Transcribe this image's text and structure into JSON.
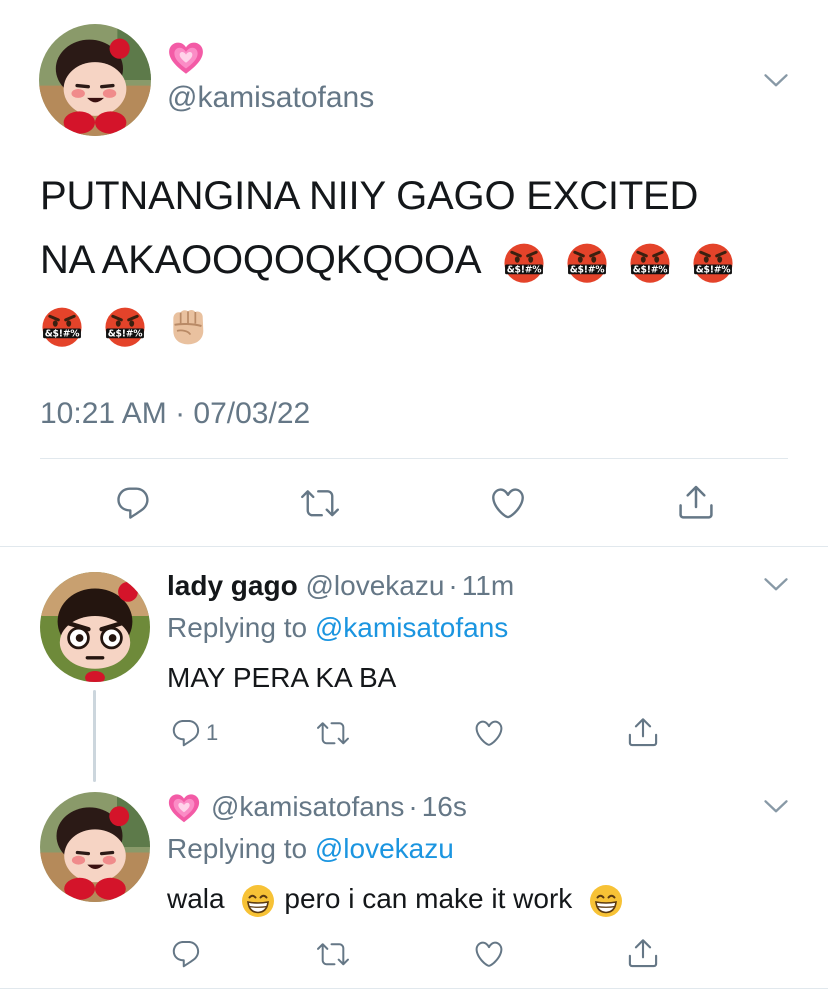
{
  "main_tweet": {
    "handle": "@kamisatofans",
    "text_line1": "PUTNANGINA NIIY GAGO EXCITED",
    "text_line2": "NA AKAOOQOQKQOOA",
    "timestamp": "10:21 AM · 07/03/22",
    "name_emoji": "sparkling-heart-emoji",
    "trailing_emojis": [
      "cursing-face-emoji",
      "cursing-face-emoji",
      "cursing-face-emoji",
      "cursing-face-emoji",
      "cursing-face-emoji",
      "cursing-face-emoji",
      "fist-emoji"
    ]
  },
  "reply1": {
    "name": "lady gago",
    "handle": "@lovekazu",
    "time": "11m",
    "replying_prefix": "Replying to",
    "replying_to": "@kamisatofans",
    "text": "MAY PERA KA BA",
    "reply_count": "1"
  },
  "reply2": {
    "handle": "@kamisatofans",
    "time": "16s",
    "replying_prefix": "Replying to",
    "replying_to": "@lovekazu",
    "text_part1": "wala",
    "text_part2": "pero i can make it work",
    "name_emoji": "sparkling-heart-emoji"
  },
  "separator": "·",
  "colors": {
    "text": "#14171a",
    "secondary": "#657786",
    "link": "#1b95e0",
    "divider": "#e1e8ed",
    "thread_line": "#ccd6dd"
  }
}
